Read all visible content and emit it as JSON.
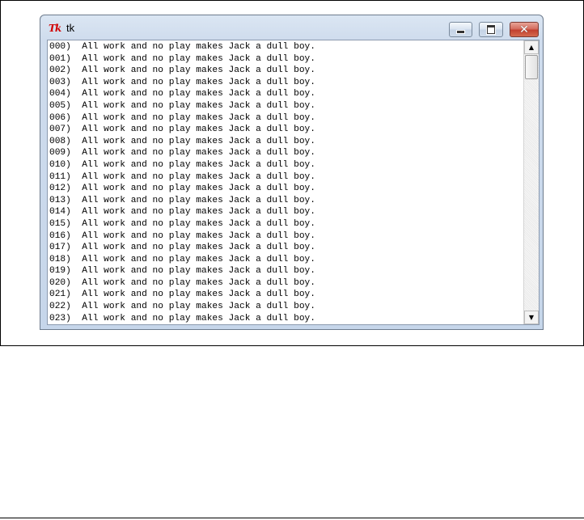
{
  "window": {
    "title": "tk",
    "icon": "tk-feather-icon",
    "buttons": {
      "minimize_icon": "minimize-icon",
      "maximize_icon": "maximize-icon",
      "close_icon": "close-icon",
      "close_glyph": "✕"
    }
  },
  "text": {
    "lines": [
      "000)  All work and no play makes Jack a dull boy.",
      "001)  All work and no play makes Jack a dull boy.",
      "002)  All work and no play makes Jack a dull boy.",
      "003)  All work and no play makes Jack a dull boy.",
      "004)  All work and no play makes Jack a dull boy.",
      "005)  All work and no play makes Jack a dull boy.",
      "006)  All work and no play makes Jack a dull boy.",
      "007)  All work and no play makes Jack a dull boy.",
      "008)  All work and no play makes Jack a dull boy.",
      "009)  All work and no play makes Jack a dull boy.",
      "010)  All work and no play makes Jack a dull boy.",
      "011)  All work and no play makes Jack a dull boy.",
      "012)  All work and no play makes Jack a dull boy.",
      "013)  All work and no play makes Jack a dull boy.",
      "014)  All work and no play makes Jack a dull boy.",
      "015)  All work and no play makes Jack a dull boy.",
      "016)  All work and no play makes Jack a dull boy.",
      "017)  All work and no play makes Jack a dull boy.",
      "018)  All work and no play makes Jack a dull boy.",
      "019)  All work and no play makes Jack a dull boy.",
      "020)  All work and no play makes Jack a dull boy.",
      "021)  All work and no play makes Jack a dull boy.",
      "022)  All work and no play makes Jack a dull boy.",
      "023)  All work and no play makes Jack a dull boy."
    ]
  },
  "scrollbar": {
    "up_arrow": "▲",
    "down_arrow": "▼",
    "position_fraction": 0.0
  },
  "colors": {
    "close_button": "#c2402f",
    "tk_logo": "#d10000",
    "titlebar": "#cfdced"
  }
}
